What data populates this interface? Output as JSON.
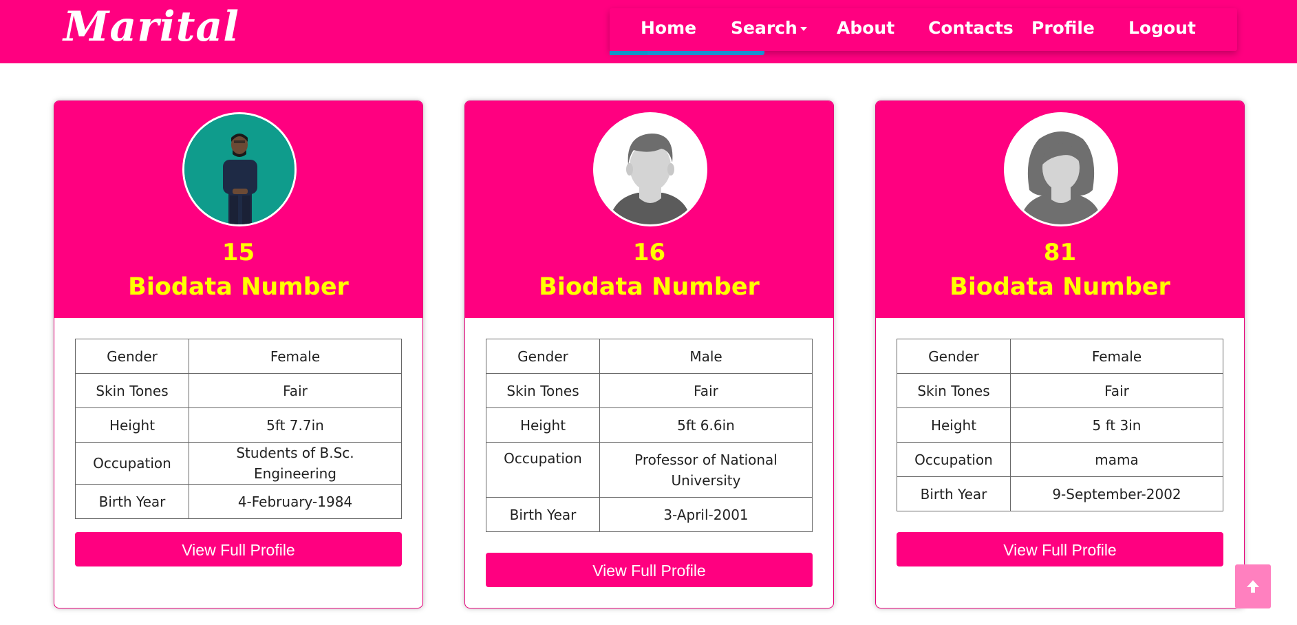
{
  "app": {
    "logo": "Marital"
  },
  "nav": {
    "items": [
      {
        "label": "Home"
      },
      {
        "label": "Search"
      },
      {
        "label": "About"
      },
      {
        "label": "Contacts"
      },
      {
        "label": "Profile"
      },
      {
        "label": "Logout"
      }
    ]
  },
  "colors": {
    "brand": "#ff0080",
    "accent_text": "#ffff00",
    "underline": "#1a8fd0"
  },
  "cards": [
    {
      "number": "15",
      "title": "Biodata Number",
      "avatar": "photo-avatar",
      "rows": [
        {
          "k": "Gender",
          "v": "Female"
        },
        {
          "k": "Skin Tones",
          "v": "Fair"
        },
        {
          "k": "Height",
          "v": "5ft 7.7in"
        },
        {
          "k": "Occupation",
          "v": "Students of B.Sc. Engineering"
        },
        {
          "k": "Birth Year",
          "v": "4-February-1984"
        }
      ],
      "button": "View Full Profile"
    },
    {
      "number": "16",
      "title": "Biodata Number",
      "avatar": "male-avatar-icon",
      "rows": [
        {
          "k": "Gender",
          "v": "Male"
        },
        {
          "k": "Skin Tones",
          "v": "Fair"
        },
        {
          "k": "Height",
          "v": "5ft 6.6in"
        },
        {
          "k": "Occupation",
          "v": "Professor of National University"
        },
        {
          "k": "Birth Year",
          "v": "3-April-2001"
        }
      ],
      "button": "View Full Profile"
    },
    {
      "number": "81",
      "title": "Biodata Number",
      "avatar": "female-avatar-icon",
      "rows": [
        {
          "k": "Gender",
          "v": "Female"
        },
        {
          "k": "Skin Tones",
          "v": "Fair"
        },
        {
          "k": "Height",
          "v": "5 ft 3in"
        },
        {
          "k": "Occupation",
          "v": "mama"
        },
        {
          "k": "Birth Year",
          "v": "9-September-2002"
        }
      ],
      "button": "View Full Profile"
    }
  ],
  "scroll_top_icon": "arrow-up-icon"
}
